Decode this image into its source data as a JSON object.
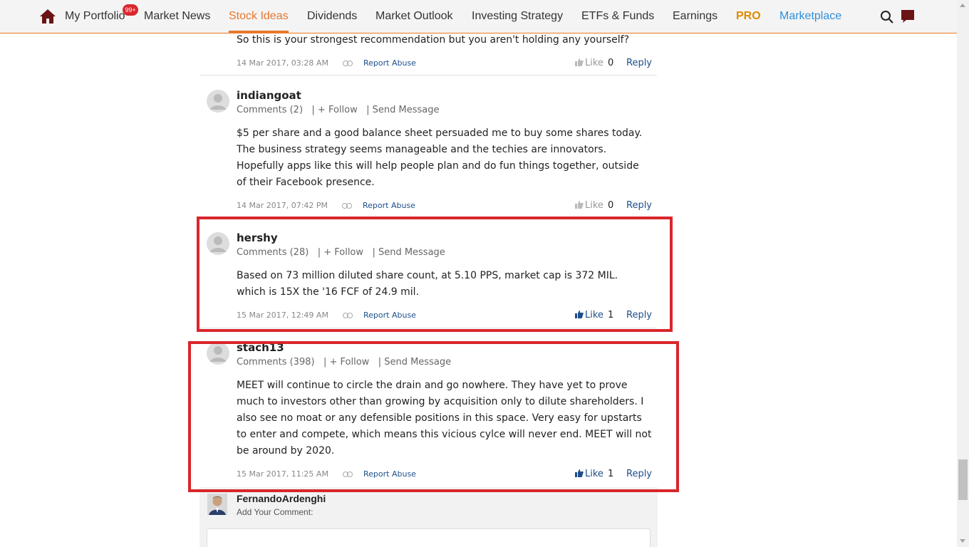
{
  "nav": {
    "items": [
      "My Portfolio",
      "Market News",
      "Stock Ideas",
      "Dividends",
      "Market Outlook",
      "Investing Strategy",
      "ETFs & Funds",
      "Earnings",
      "PRO",
      "Marketplace"
    ],
    "active": "Stock Ideas",
    "badge": "99+"
  },
  "comments": [
    {
      "text": "So this is your strongest recommendation but you aren't holding any yourself?",
      "date": "14 Mar 2017, 03:28 AM",
      "report": "Report Abuse",
      "like_label": "Like",
      "likes": "0",
      "reply": "Reply"
    },
    {
      "username": "indiangoat",
      "comments_count": "Comments (2)",
      "follow": "| + Follow",
      "send": "| Send Message",
      "lines": [
        "$5 per share and a good balance sheet persuaded me to buy some shares today.",
        "The business strategy seems manageable and the techies are innovators.",
        "Hopefully apps like this will help people plan and do fun things together, outside",
        "of their Facebook presence."
      ],
      "date": "14 Mar 2017, 07:42 PM",
      "report": "Report Abuse",
      "like_label": "Like",
      "likes": "0",
      "reply": "Reply"
    },
    {
      "username": "hershy",
      "comments_count": "Comments (28)",
      "follow": "| + Follow",
      "send": "| Send Message",
      "lines": [
        "Based on 73 million diluted share count, at 5.10 PPS, market cap is 372 MIL.",
        "which is 15X the '16 FCF of 24.9 mil."
      ],
      "date": "15 Mar 2017, 12:49 AM",
      "report": "Report Abuse",
      "like_label": "Like",
      "likes": "1",
      "reply": "Reply"
    },
    {
      "username": "stach13",
      "comments_count": "Comments (398)",
      "follow": "| + Follow",
      "send": "| Send Message",
      "lines": [
        "MEET will continue to circle the drain and go nowhere. They have yet to prove",
        "much to investors other than growing by acquisition only to dilute shareholders. I",
        "also see no moat or any defensible positions in this space. Very easy for upstarts",
        "to enter and compete, which means this vicious cylce will never end. MEET will not",
        "be around by 2020."
      ],
      "date": "15 Mar 2017, 11:25 AM",
      "report": "Report Abuse",
      "like_label": "Like",
      "likes": "1",
      "reply": "Reply"
    }
  ],
  "add_comment": {
    "username": "FernandoArdenghi",
    "label": "Add Your Comment:"
  },
  "colors": {
    "accent": "#e8772e",
    "highlight": "#d9262c",
    "link": "#1e4f8c"
  }
}
